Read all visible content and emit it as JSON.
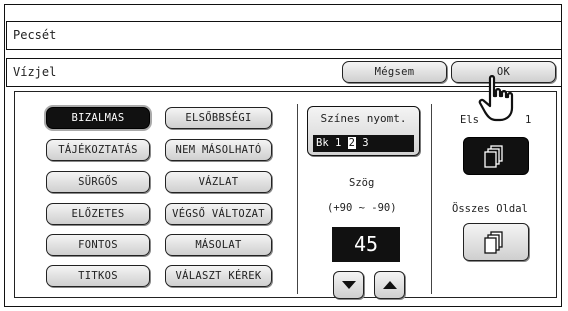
{
  "title": "Pecsét",
  "section_title": "Vízjel",
  "toolbar": {
    "cancel_label": "Mégsem",
    "ok_label": "OK"
  },
  "stamps": {
    "left_column": [
      "BIZALMAS",
      "TÁJÉKOZTATÁS",
      "SÜRGŐS",
      "ELŐZETES",
      "FONTOS",
      "TITKOS"
    ],
    "right_column": [
      "ELSŐBBSÉGI",
      "NEM MÁSOLHATÓ",
      "VÁZLAT",
      "VÉGSŐ VÁLTOZAT",
      "MÁSOLAT",
      "VÁLASZT KÉREK"
    ],
    "selected": "BIZALMAS"
  },
  "color_print": {
    "label": "Színes nyomt.",
    "options_prefix": "Bk 1 ",
    "selected_option": "2",
    "options_suffix": " 3"
  },
  "angle": {
    "label": "Szög",
    "range": "(+90 ~ -90)",
    "value": "45"
  },
  "pages": {
    "first_page_label": "Els",
    "first_page_suffix": "1",
    "all_pages_label": "Összes Oldal"
  },
  "icons": {
    "down": "triangle-down-icon",
    "up": "triangle-up-icon",
    "first_page": "pages-icon",
    "all_pages": "pages-icon",
    "pointer": "hand-pointer-icon"
  }
}
